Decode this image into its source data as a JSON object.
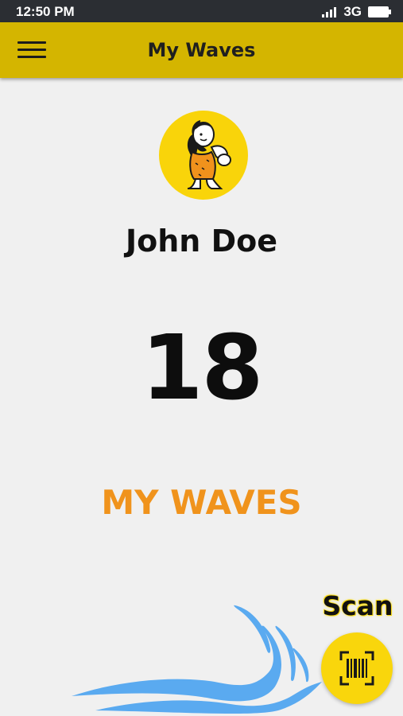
{
  "status_bar": {
    "time": "12:50 PM",
    "network": "3G",
    "icons": [
      "signal-icon",
      "battery-icon"
    ]
  },
  "app_bar": {
    "title": "My Waves",
    "menu_icon": "hamburger-menu-icon"
  },
  "profile": {
    "avatar_icon": "caveman-mascot-icon",
    "name": "John Doe"
  },
  "waves": {
    "count": "18",
    "label": "MY WAVES"
  },
  "scan": {
    "label": "Scan",
    "icon": "barcode-scan-icon"
  },
  "colors": {
    "app_bar": "#d4b500",
    "accent_yellow": "#f9d40a",
    "label_orange": "#f0931c",
    "wave_blue": "#5aaaf0",
    "background": "#f0f0f0"
  }
}
